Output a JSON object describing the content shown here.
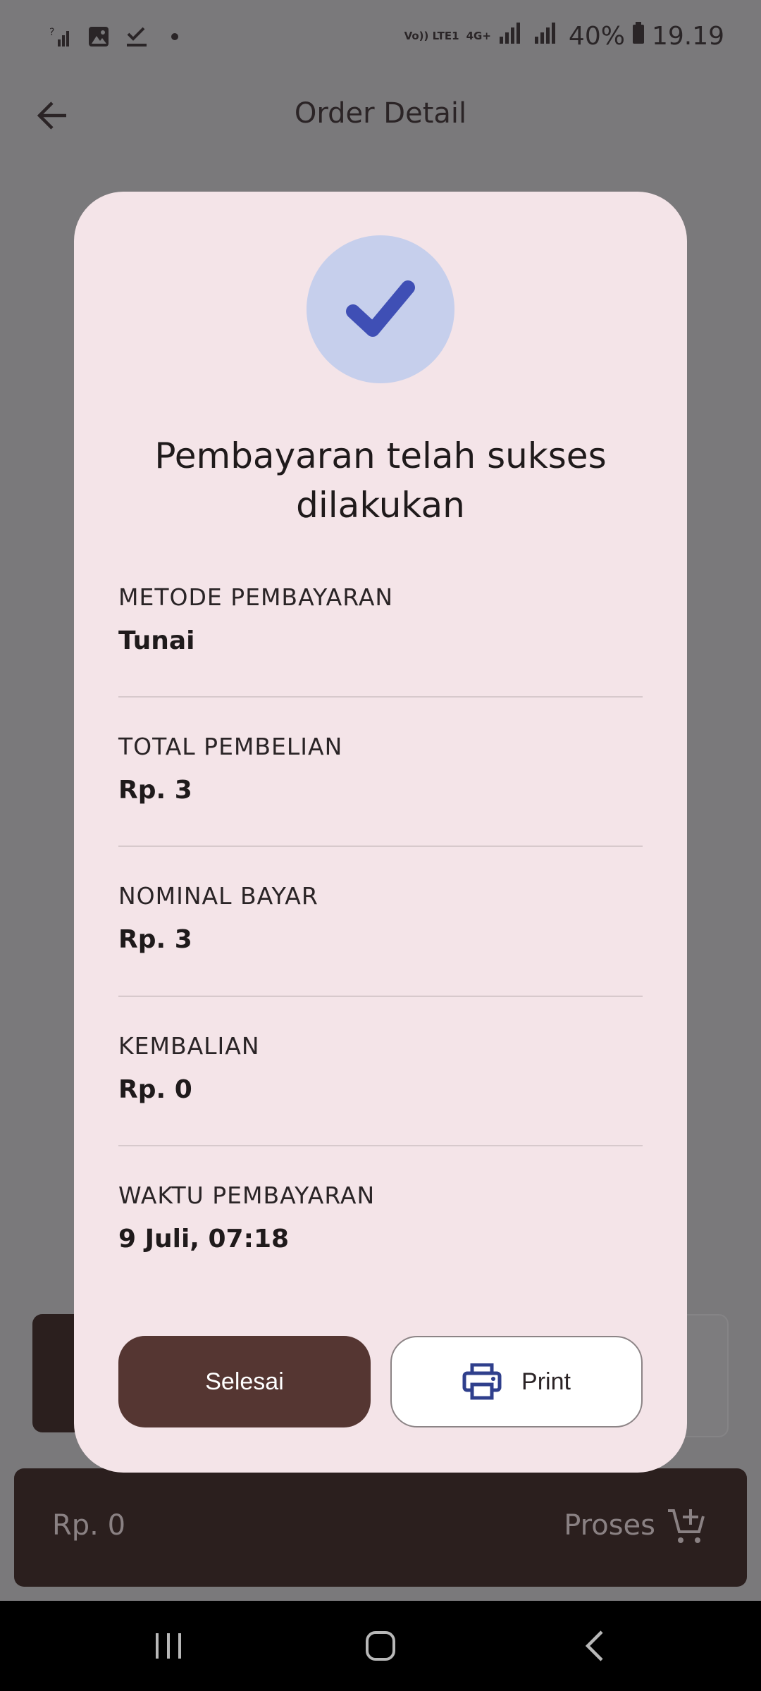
{
  "status_bar": {
    "battery": "40%",
    "time": "19.19",
    "network_volte": "Vo)) LTE1",
    "network_4g": "4G+"
  },
  "app_bar": {
    "title": "Order Detail"
  },
  "dialog": {
    "title": "Pembayaran telah sukses dilakukan",
    "fields": [
      {
        "label": "METODE PEMBAYARAN",
        "value": "Tunai"
      },
      {
        "label": "TOTAL PEMBELIAN",
        "value": "Rp. 3"
      },
      {
        "label": "NOMINAL BAYAR",
        "value": "Rp. 3"
      },
      {
        "label": "KEMBALIAN",
        "value": "Rp. 0"
      },
      {
        "label": "WAKTU PEMBAYARAN",
        "value": "9 Juli, 07:18"
      }
    ],
    "done_label": "Selesai",
    "print_label": "Print"
  },
  "bottom_bar": {
    "total": "Rp. 0",
    "proses_label": "Proses"
  },
  "colors": {
    "dialog_bg": "#f4e4e8",
    "primary_brown": "#553632",
    "check_blue": "#3f4fb5",
    "check_bg": "#c6cfec",
    "bar_dark": "#2b1f1e"
  },
  "icons": [
    "signal-unknown-icon",
    "image-icon",
    "check-icon",
    "back-arrow-icon",
    "checkmark-icon",
    "printer-icon",
    "add-cart-icon",
    "recents-icon",
    "home-icon",
    "back-nav-icon"
  ]
}
